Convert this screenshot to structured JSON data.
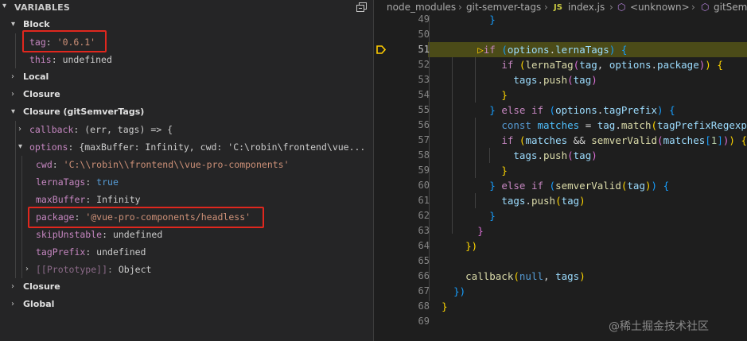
{
  "variables_panel": {
    "title": "VARIABLES",
    "collapse_icon": "collapse-all-icon",
    "scopes": {
      "block": {
        "label": "Block",
        "tag": {
          "name": "tag",
          "value": "'0.6.1'"
        },
        "this": {
          "name": "this",
          "value": "undefined"
        }
      },
      "local": {
        "label": "Local"
      },
      "closure1": {
        "label": "Closure"
      },
      "closure_git": {
        "label": "Closure (gitSemverTags)",
        "callback": {
          "name": "callback",
          "value": "(err, tags) => {"
        },
        "options": {
          "name": "options",
          "value": "{maxBuffer: Infinity, cwd: 'C:\\robin\\frontend\\vue..."
        },
        "cwd": {
          "name": "cwd",
          "value": "'C:\\\\robin\\\\frontend\\\\vue-pro-components'"
        },
        "lernaTags": {
          "name": "lernaTags",
          "value": "true"
        },
        "maxBuffer": {
          "name": "maxBuffer",
          "value": "Infinity"
        },
        "package": {
          "name": "package",
          "value": "'@vue-pro-components/headless'"
        },
        "skipUnstable": {
          "name": "skipUnstable",
          "value": "undefined"
        },
        "tagPrefix": {
          "name": "tagPrefix",
          "value": "undefined"
        },
        "prototype": {
          "name": "[[Prototype]]",
          "value": "Object"
        }
      },
      "closure2": {
        "label": "Closure"
      },
      "global": {
        "label": "Global"
      }
    }
  },
  "editor": {
    "breadcrumbs": [
      "node_modules",
      "git-semver-tags",
      "JS",
      "index.js",
      "<unknown>",
      "gitSemv"
    ],
    "active_line": "51",
    "line_numbers": [
      "49",
      "50",
      "51",
      "52",
      "53",
      "54",
      "55",
      "56",
      "57",
      "58",
      "59",
      "60",
      "61",
      "62",
      "63",
      "64",
      "65",
      "66",
      "67",
      "68",
      "69"
    ]
  },
  "watermark": "@稀土掘金技术社区"
}
